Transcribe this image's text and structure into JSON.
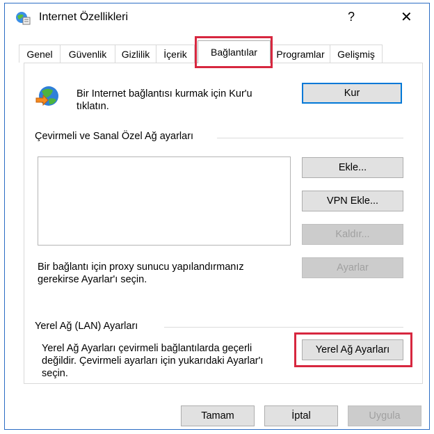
{
  "window": {
    "title": "Internet Özellikleri",
    "help_glyph": "?",
    "close_glyph": "✕",
    "icon": "internet-options-icon"
  },
  "tabs": [
    {
      "label": "Genel"
    },
    {
      "label": "Güvenlik"
    },
    {
      "label": "Gizlilik"
    },
    {
      "label": "İçerik"
    },
    {
      "label": "Bağlantılar",
      "active": true
    },
    {
      "label": "Programlar"
    },
    {
      "label": "Gelişmiş"
    }
  ],
  "setup": {
    "icon": "network-globe-icon",
    "text_line1": "Bir Internet bağlantısı kurmak için Kur'u",
    "text_line2": "tıklatın.",
    "button": "Kur"
  },
  "dialup": {
    "group_label": "Çevirmeli ve Sanal Özel Ağ ayarları",
    "list_items": [],
    "add_button": "Ekle...",
    "add_vpn_button": "VPN Ekle...",
    "remove_button": "Kaldır...",
    "proxy_text_line1": "Bir bağlantı için proxy sunucu yapılandırmanız",
    "proxy_text_line2": "gerekirse Ayarlar'ı seçin.",
    "settings_button": "Ayarlar"
  },
  "lan": {
    "group_label": "Yerel Ağ (LAN) Ayarları",
    "text_line1": "Yerel Ağ Ayarları çevirmeli bağlantılarda geçerli",
    "text_line2": "değildir. Çevirmeli ayarları için yukarıdaki Ayarlar'ı",
    "text_line3": "seçin.",
    "button": "Yerel Ağ Ayarları"
  },
  "footer": {
    "ok": "Tamam",
    "cancel": "İptal",
    "apply": "Uygula"
  },
  "colors": {
    "highlight": "#d7273f",
    "accent": "#0078d7",
    "disabled_text": "#a0a0a0"
  }
}
